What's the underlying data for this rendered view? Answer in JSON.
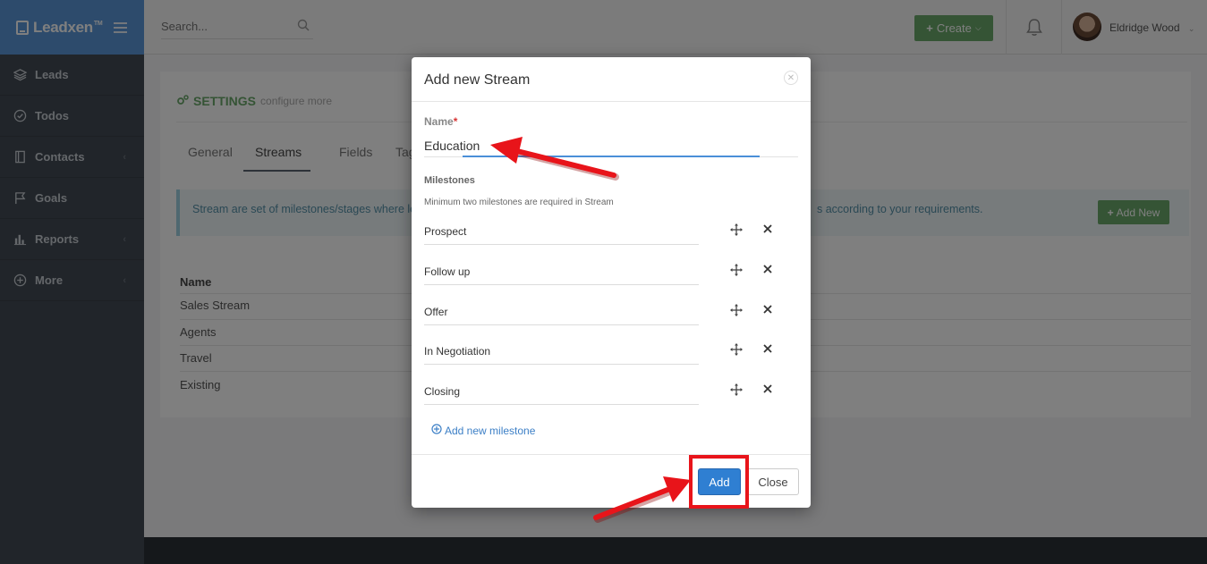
{
  "brand": {
    "name": "Leadxen",
    "trademark": "TM"
  },
  "sidebar": {
    "items": [
      {
        "label": "Leads",
        "icon": "layers-icon",
        "has_submenu": false
      },
      {
        "label": "Todos",
        "icon": "check-circle-icon",
        "has_submenu": false
      },
      {
        "label": "Contacts",
        "icon": "contact-book-icon",
        "has_submenu": true
      },
      {
        "label": "Goals",
        "icon": "flag-icon",
        "has_submenu": false
      },
      {
        "label": "Reports",
        "icon": "bar-chart-icon",
        "has_submenu": true
      },
      {
        "label": "More",
        "icon": "plus-circle-icon",
        "has_submenu": true
      }
    ]
  },
  "header": {
    "search_placeholder": "Search...",
    "create_label": "Create",
    "user_name": "Eldridge Wood"
  },
  "page": {
    "settings_title": "SETTINGS",
    "settings_subtitle": "configure more",
    "tabs": [
      {
        "label": "General",
        "active": false
      },
      {
        "label": "Streams",
        "active": true
      },
      {
        "label": "Fields",
        "active": false
      },
      {
        "label": "Tags",
        "active": false
      }
    ],
    "info_text_start": "Stream are set of milestones/stages where le",
    "info_text_end": "s according to your requirements.",
    "add_new_label": "Add New",
    "table": {
      "header": "Name",
      "rows": [
        "Sales Stream",
        "Agents",
        "Travel",
        "Existing"
      ]
    }
  },
  "modal": {
    "title": "Add new Stream",
    "name_label": "Name",
    "required_mark": "*",
    "name_value": "Education",
    "milestones_title": "Milestones",
    "milestones_hint": "Minimum two milestones are required in Stream",
    "milestones": [
      "Prospect",
      "Follow up",
      "Offer",
      "In Negotiation",
      "Closing"
    ],
    "add_milestone_label": "Add new milestone",
    "add_button": "Add",
    "close_button": "Close"
  },
  "colors": {
    "sidebar_bg": "#424a54",
    "brand_bg": "#5a97d8",
    "success_green": "#6aa86a",
    "primary_blue": "#2f7fd2",
    "annotation_red": "#e8141a"
  }
}
